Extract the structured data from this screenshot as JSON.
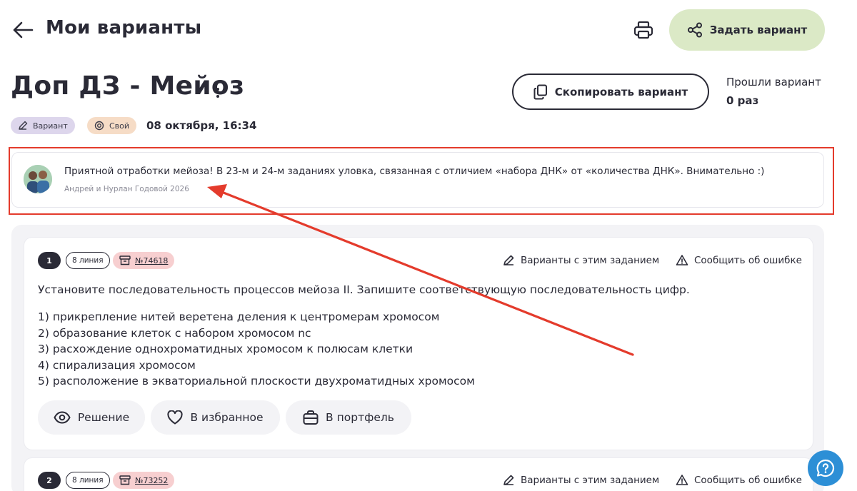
{
  "header": {
    "title": "Мои варианты",
    "assign_label": "Задать вариант"
  },
  "variant": {
    "title": "Доп ДЗ - Мейоз",
    "copy_label": "Скопировать вариант",
    "passed_label": "Прошли вариант",
    "passed_count": "0 раз",
    "badge_variant": "Вариант",
    "badge_own": "Свой",
    "date": "08 октября, 16:34"
  },
  "comment": {
    "text": "Приятной отработки мейоза! В 23-м и 24-м заданиях уловка, связанная с отличием «набора ДНК» от «количества ДНК». Внимательно :)",
    "author": "Андрей и Нурлан Годовой 2026"
  },
  "tasks": [
    {
      "number": "1",
      "line": "8 линия",
      "id": "№74618",
      "action_variants": "Варианты с этим заданием",
      "action_report": "Сообщить об ошибке",
      "question": "Установите последовательность процессов мейоза II. Запишите соответствующую последовательность цифр.",
      "options": [
        "1) прикрепление нитей веретена деления к центромерам хромосом",
        "2) образование клеток с набором хромосом nc",
        "3) расхождение однохроматидных хромосом к полюсам клетки",
        "4) спирализация хромосом",
        "5) расположение в экваториальной плоскости двухроматидных хромосом"
      ],
      "btn_solution": "Решение",
      "btn_favorite": "В избранное",
      "btn_portfolio": "В портфель"
    },
    {
      "number": "2",
      "line": "8 линия",
      "id": "№73252",
      "action_variants": "Варианты с этим заданием",
      "action_report": "Сообщить об ошибке"
    }
  ],
  "colors": {
    "highlight": "#e43b2c",
    "assign_bg": "#dbe9c6",
    "help_bg": "#2d8fd6",
    "id_pill_bg": "#f7cfd0"
  },
  "icons": [
    "back-arrow-icon",
    "printer-icon",
    "share-icon",
    "copy-icon",
    "pencil-icon",
    "at-sign-icon",
    "archive-icon",
    "edit-icon",
    "warning-icon",
    "eye-icon",
    "heart-icon",
    "briefcase-icon",
    "help-chat-icon"
  ]
}
